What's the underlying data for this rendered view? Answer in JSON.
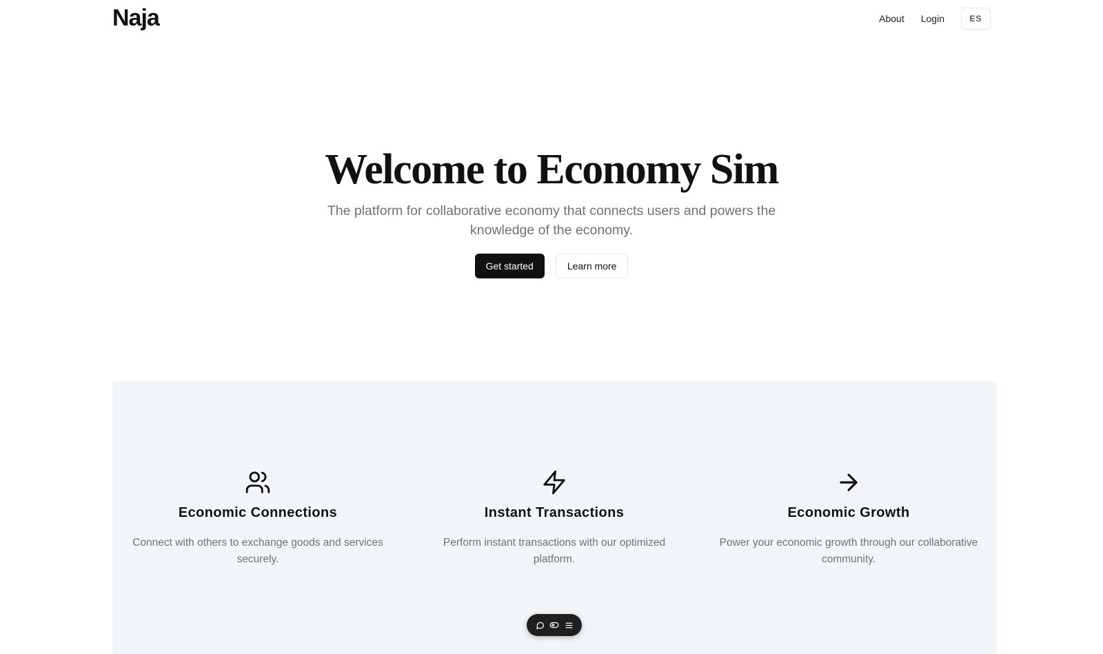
{
  "header": {
    "logo": "Naja",
    "nav": [
      {
        "label": "About"
      },
      {
        "label": "Login"
      }
    ],
    "language_button": "ES"
  },
  "hero": {
    "title": "Welcome to Economy Sim",
    "subtitle": "The platform for collaborative economy that connects users and powers the knowledge of the economy.",
    "primary_button": "Get started",
    "secondary_button": "Learn more"
  },
  "features": [
    {
      "icon": "users-icon",
      "title": "Economic Connections",
      "description": "Connect with others to exchange goods and services securely."
    },
    {
      "icon": "zap-icon",
      "title": "Instant Transactions",
      "description": "Perform instant transactions with our optimized platform."
    },
    {
      "icon": "arrow-right-icon",
      "title": "Economic Growth",
      "description": "Power your economic growth through our collaborative community."
    }
  ],
  "toolbar": {
    "icons": [
      "chat-icon",
      "toggle-icon",
      "menu-icon"
    ]
  },
  "colors": {
    "text_primary": "#111111",
    "text_muted": "#6b7280",
    "feature_bg": "#f2f5f7",
    "primary_button_bg": "#111111",
    "border": "#e2e5e9"
  }
}
